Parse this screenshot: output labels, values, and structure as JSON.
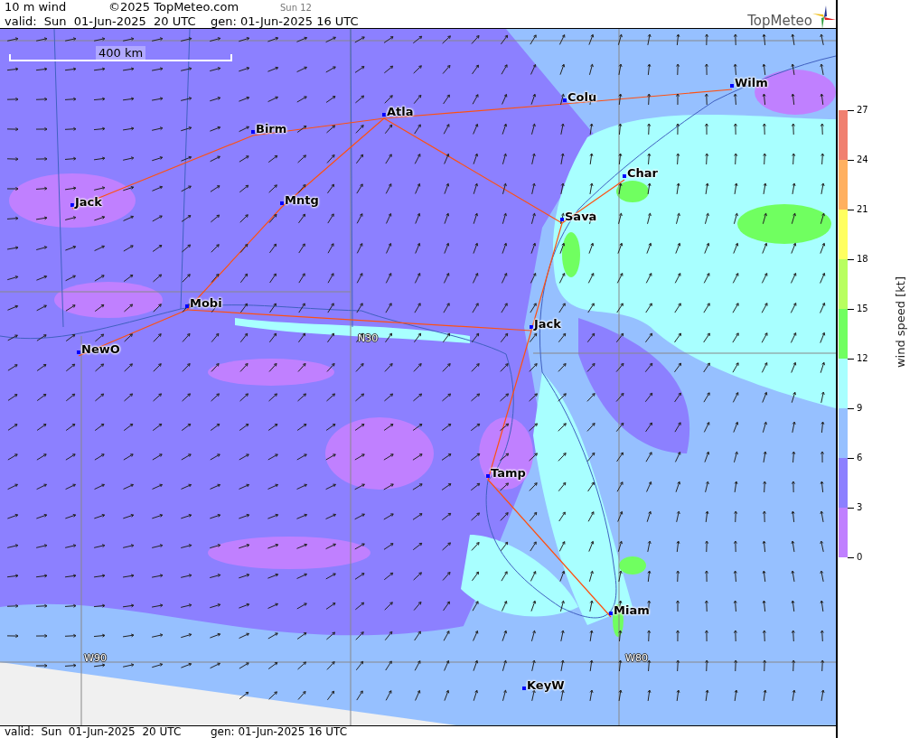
{
  "header": {
    "title": "10 m wind",
    "copyright": "©2025 TopMeteo.com",
    "run": "Sun 12",
    "valid": "valid:  Sun  01-Jun-2025  20 UTC",
    "generated": "gen: 01-Jun-2025 16 UTC",
    "logo": "TopMeteo"
  },
  "map": {
    "scale": "400 km",
    "grid_labels": [
      {
        "text": "N30"
      },
      {
        "text": "W90"
      },
      {
        "text": "W80"
      }
    ],
    "cities": [
      {
        "name": "Birm"
      },
      {
        "name": "Atla"
      },
      {
        "name": "Colu"
      },
      {
        "name": "Wilm"
      },
      {
        "name": "Jack"
      },
      {
        "name": "Mntg"
      },
      {
        "name": "Char"
      },
      {
        "name": "Sava"
      },
      {
        "name": "Mobi"
      },
      {
        "name": "Jack"
      },
      {
        "name": "NewO"
      },
      {
        "name": "Tamp"
      },
      {
        "name": "Miam"
      },
      {
        "name": "KeyW"
      }
    ]
  },
  "legend": {
    "title": "wind speed [kt]",
    "ticks": [
      "27",
      "24",
      "21",
      "18",
      "15",
      "12",
      "9",
      "6",
      "3",
      "0"
    ],
    "bands": [
      {
        "color": "#c080ff"
      },
      {
        "color": "#8c80ff"
      },
      {
        "color": "#96c0ff"
      },
      {
        "color": "#a8ffff"
      },
      {
        "color": "#70ff60"
      },
      {
        "color": "#b8ff60"
      },
      {
        "color": "#ffff60"
      },
      {
        "color": "#ffb060"
      },
      {
        "color": "#f08070"
      }
    ]
  },
  "footer": {
    "valid": "valid:  Sun  01-Jun-2025  20 UTC",
    "generated": "gen: 01-Jun-2025 16 UTC"
  }
}
